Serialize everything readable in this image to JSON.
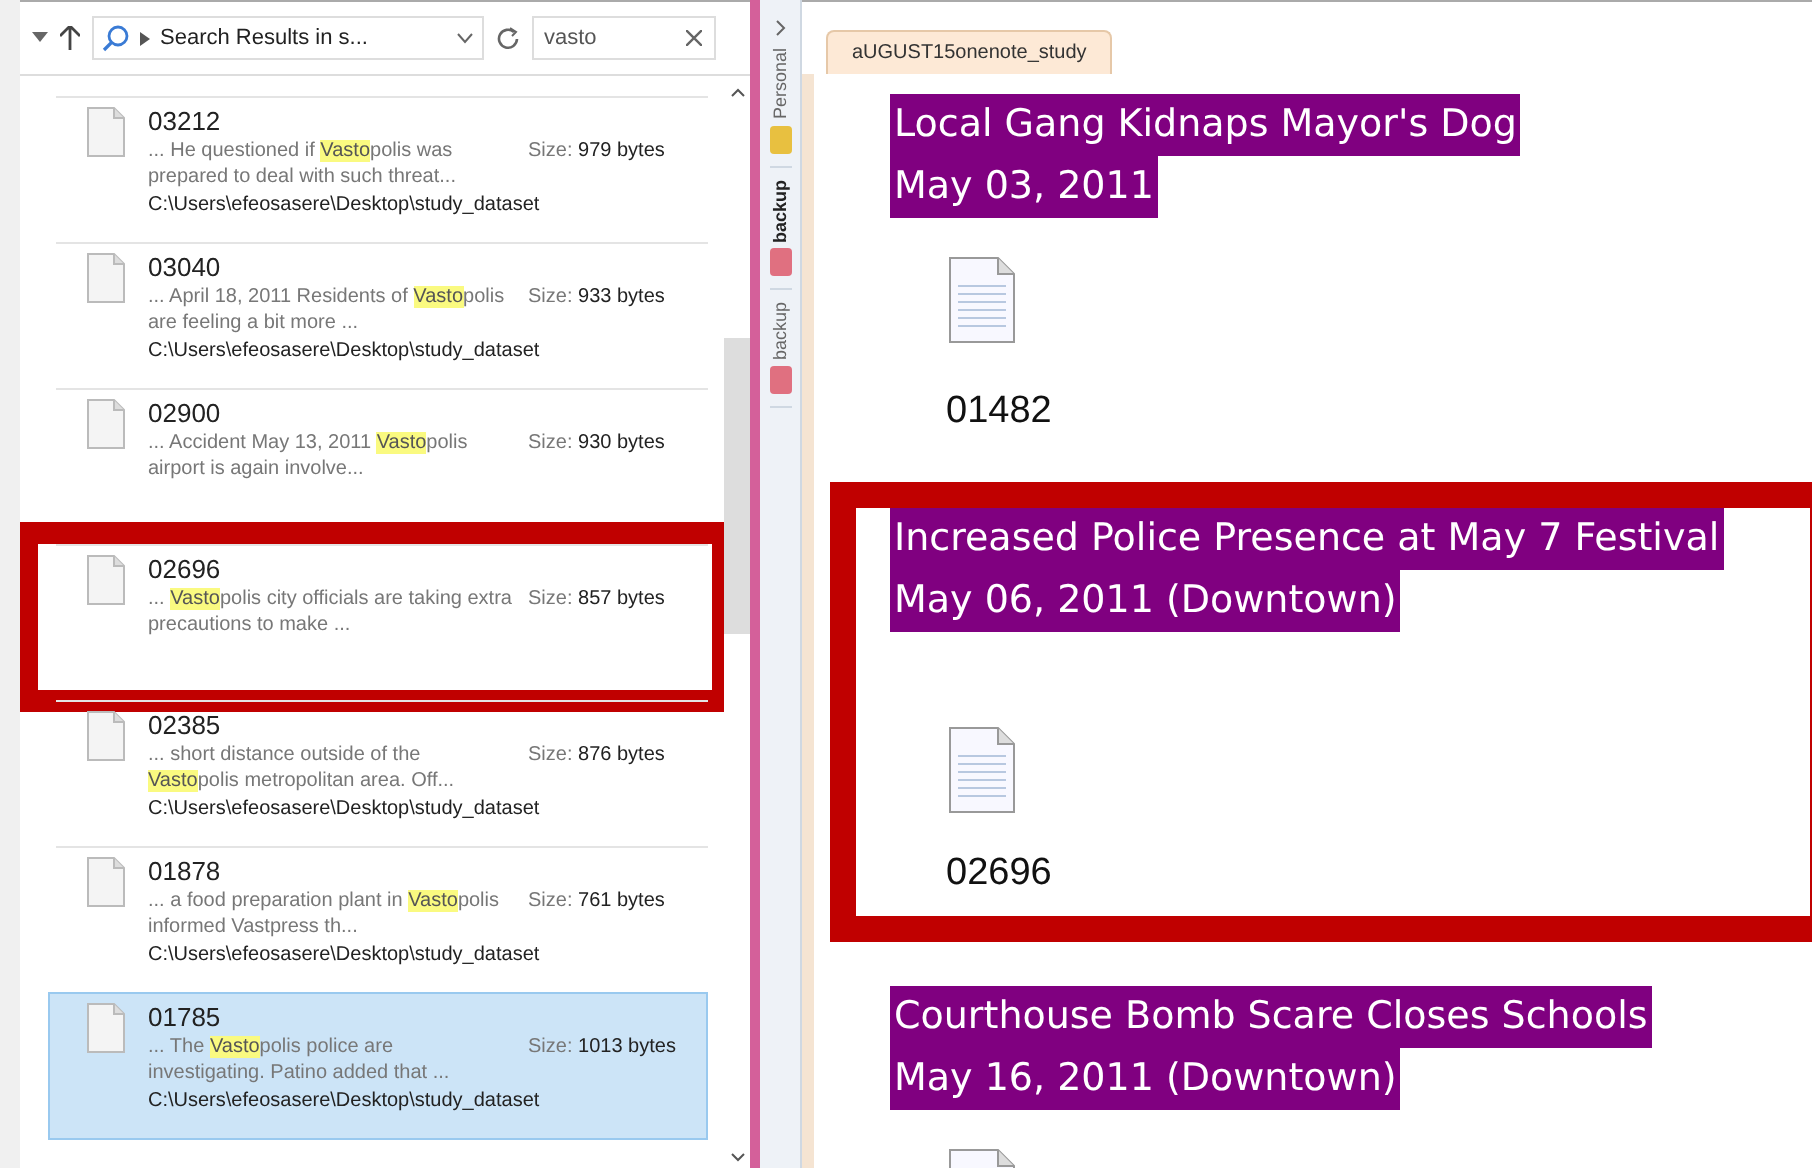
{
  "explorer": {
    "address": "Search Results in s...",
    "search": {
      "value": "vasto"
    },
    "results": [
      {
        "name": "03212",
        "snippet": [
          {
            "text": "... He questioned if ",
            "highlight": false
          },
          {
            "text": "Vasto",
            "highlight": true
          },
          {
            "text": "polis was prepared to deal with such threat...",
            "highlight": false
          }
        ],
        "size": "Size: **979 bytes**",
        "path": "C:\\Users\\efeosasere\\Desktop\\study_dataset",
        "selected": false,
        "annotated": false
      },
      {
        "name": "03040",
        "snippet": [
          {
            "text": "... April 18, 2011 Residents of ",
            "highlight": false
          },
          {
            "text": "Vasto",
            "highlight": true
          },
          {
            "text": "polis are feeling a bit more ...",
            "highlight": false
          }
        ],
        "size": "Size: **933 bytes**",
        "path": "C:\\Users\\efeosasere\\Desktop\\study_dataset",
        "selected": false,
        "annotated": false
      },
      {
        "name": "02900",
        "snippet": [
          {
            "text": "... Accident May 13, 2011 ",
            "highlight": false
          },
          {
            "text": "Vasto",
            "highlight": true
          },
          {
            "text": "polis airport is again involve...",
            "highlight": false
          }
        ],
        "size": "Size: **930 bytes**",
        "selected": false,
        "annotated": false
      },
      {
        "name": "02696",
        "snippet": [
          {
            "text": "... ",
            "highlight": false
          },
          {
            "text": "Vasto",
            "highlight": true
          },
          {
            "text": "polis city officials are taking extra precautions to make ...",
            "highlight": false
          }
        ],
        "size": "Size: **857 bytes**",
        "selected": false,
        "annotated": true
      },
      {
        "name": "02385",
        "snippet": [
          {
            "text": "... short distance outside of the ",
            "highlight": false
          },
          {
            "text": "Vasto",
            "highlight": true
          },
          {
            "text": "polis metropolitan area. Off...",
            "highlight": false
          }
        ],
        "size": "Size: **876 bytes**",
        "path": "C:\\Users\\efeosasere\\Desktop\\study_dataset",
        "selected": false,
        "annotated": false
      },
      {
        "name": "01878",
        "snippet": [
          {
            "text": "... a food preparation plant in ",
            "highlight": false
          },
          {
            "text": "Vasto",
            "highlight": true
          },
          {
            "text": "polis informed Vastpress th...",
            "highlight": false
          }
        ],
        "size": "Size: **761 bytes**",
        "path": "C:\\Users\\efeosasere\\Desktop\\study_dataset",
        "selected": false,
        "annotated": false
      },
      {
        "name": "01785",
        "snippet": [
          {
            "text": "... The ",
            "highlight": false
          },
          {
            "text": "Vasto",
            "highlight": true
          },
          {
            "text": "polis police are investigating. Patino added that ...",
            "highlight": false
          }
        ],
        "size": "Size: **1013 bytes**",
        "path": "C:\\Users\\efeosasere\\Desktop\\study_dataset",
        "selected": true,
        "annotated": false
      }
    ]
  },
  "onenote": {
    "sections": [
      {
        "label": "Personal",
        "selected": false,
        "color": "#e8c040"
      },
      {
        "label": "backup",
        "selected": true,
        "color": "#e07080"
      },
      {
        "label": "backup",
        "selected": false,
        "color": "#e07080"
      }
    ],
    "page_tab": "aUGUST15onenote_study",
    "notes": [
      {
        "title": "Local Gang Kidnaps Mayor's Dog",
        "date": "May 03, 2011",
        "file": "01482",
        "annotated": false
      },
      {
        "title": "Increased Police Presence at May 7 Festival",
        "date": "May 06, 2011 (Downtown)",
        "file": "02696",
        "annotated": true
      },
      {
        "title": "Courthouse Bomb Scare Closes Schools",
        "date": "May 16, 2011 (Downtown)",
        "annotated": false
      }
    ]
  }
}
